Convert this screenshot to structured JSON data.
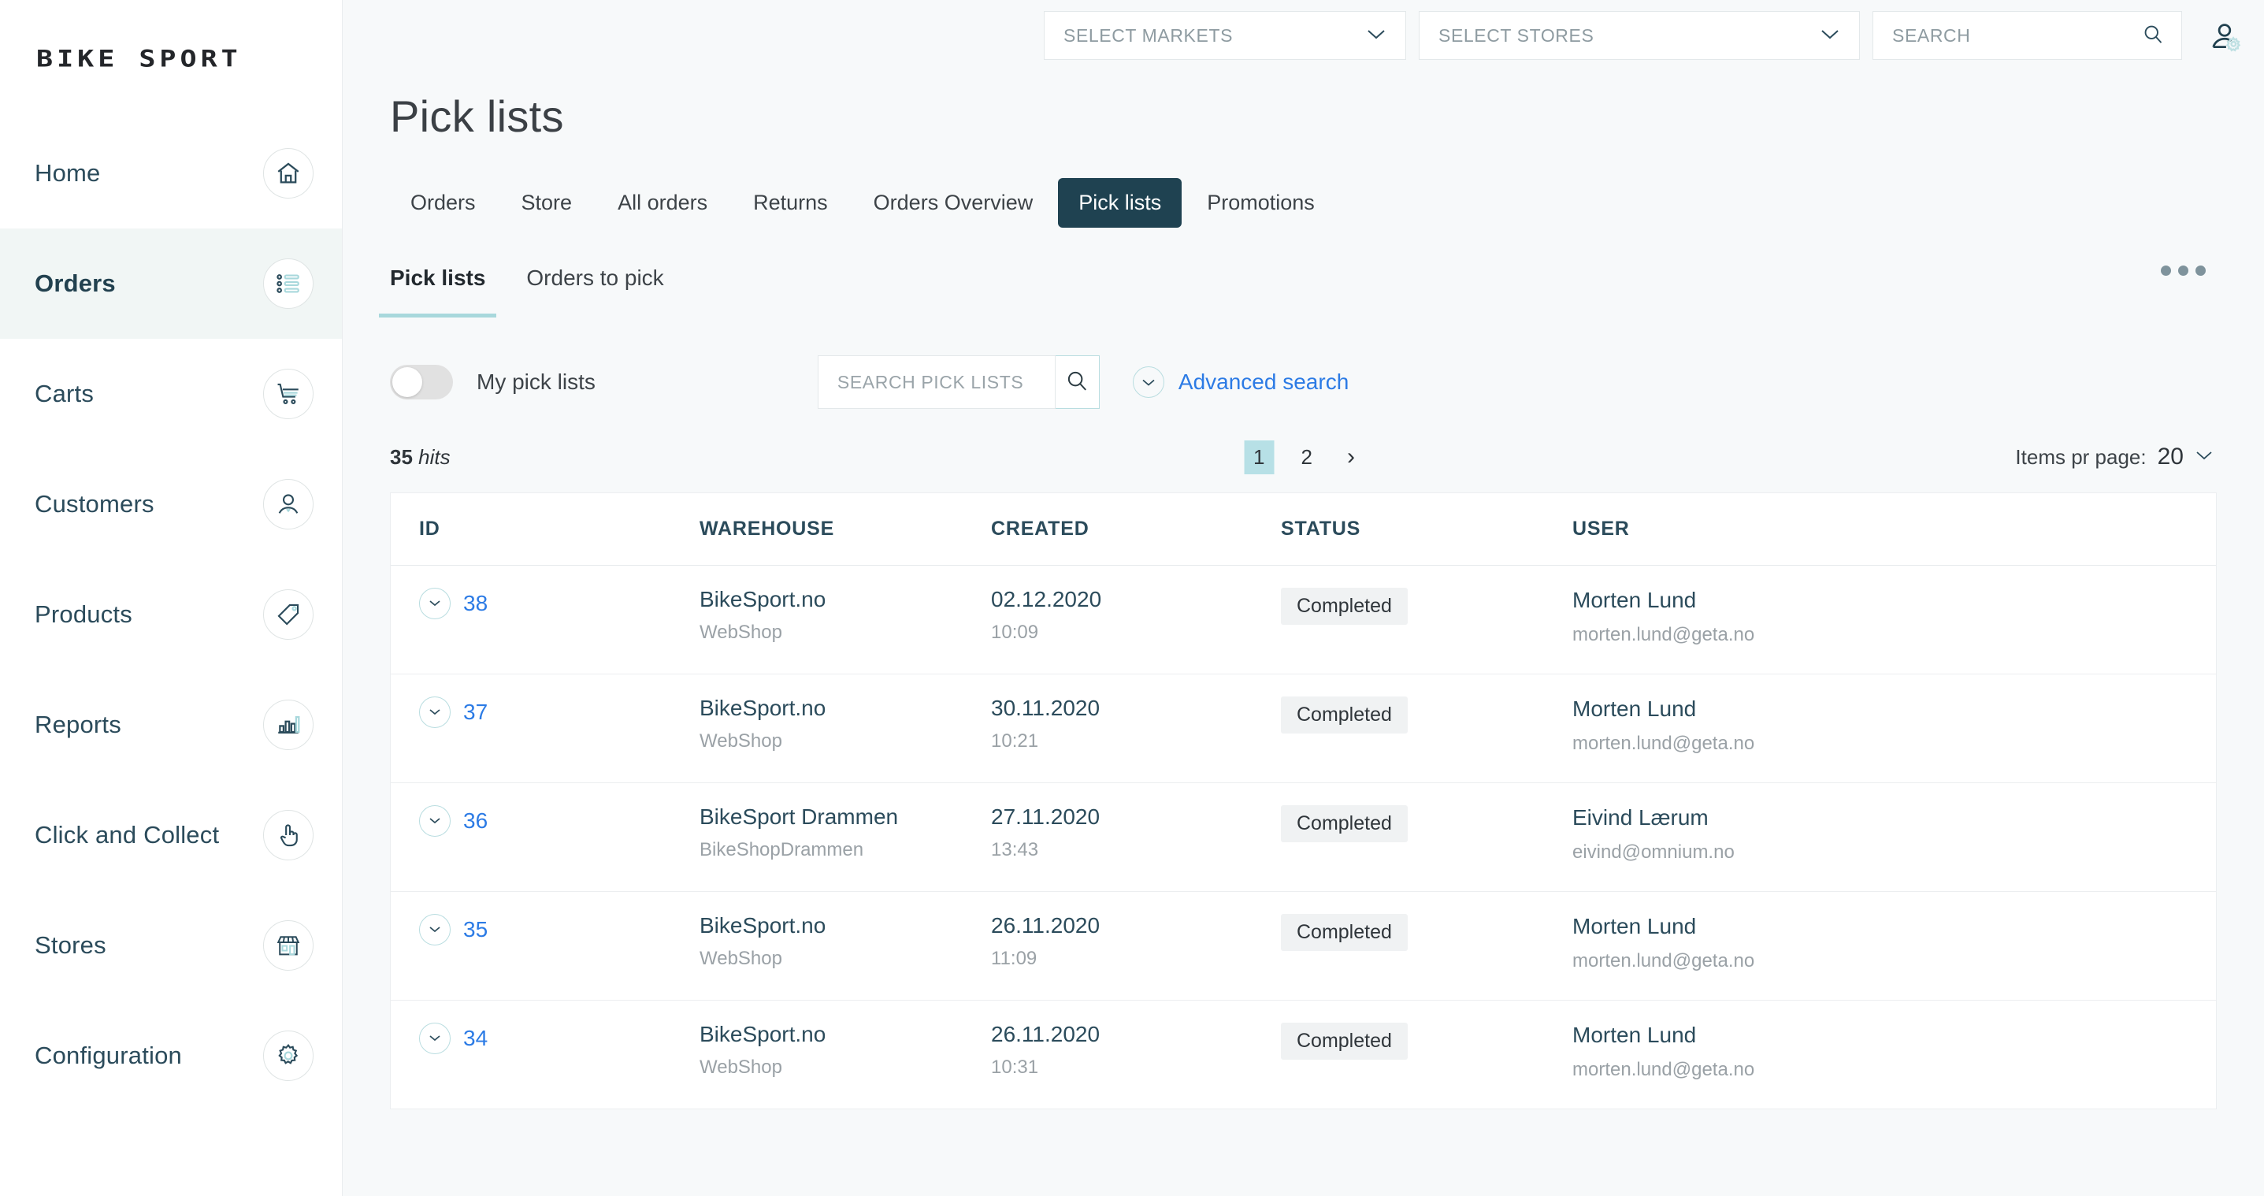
{
  "brand": {
    "logo": "BIKE SPORT"
  },
  "header": {
    "select_markets": "SELECT MARKETS",
    "select_stores": "SELECT STORES",
    "search_placeholder": "SEARCH",
    "search_value": "",
    "avatar_icon": "user-settings-icon"
  },
  "sidebar": {
    "items": [
      {
        "label": "Home",
        "icon": "home-icon",
        "active": false
      },
      {
        "label": "Orders",
        "icon": "list-icon",
        "active": true
      },
      {
        "label": "Carts",
        "icon": "cart-icon",
        "active": false
      },
      {
        "label": "Customers",
        "icon": "customer-icon",
        "active": false
      },
      {
        "label": "Products",
        "icon": "tag-icon",
        "active": false
      },
      {
        "label": "Reports",
        "icon": "bar-chart-icon",
        "active": false
      },
      {
        "label": "Click and Collect",
        "icon": "pointing-hand-icon",
        "active": false
      },
      {
        "label": "Stores",
        "icon": "storefront-icon",
        "active": false
      },
      {
        "label": "Configuration",
        "icon": "gear-icon",
        "active": false
      }
    ]
  },
  "page": {
    "title": "Pick lists"
  },
  "tabs": [
    {
      "label": "Orders",
      "active": false
    },
    {
      "label": "Store",
      "active": false
    },
    {
      "label": "All orders",
      "active": false
    },
    {
      "label": "Returns",
      "active": false
    },
    {
      "label": "Orders Overview",
      "active": false
    },
    {
      "label": "Pick lists",
      "active": true
    },
    {
      "label": "Promotions",
      "active": false
    }
  ],
  "subtabs": [
    {
      "label": "Pick lists",
      "active": true
    },
    {
      "label": "Orders to pick",
      "active": false
    }
  ],
  "toolbar": {
    "toggle_label": "My pick lists",
    "toggle_on": false,
    "search_placeholder": "SEARCH PICK LISTS",
    "search_value": "",
    "search_icon": "search-icon",
    "advanced_search_label": "Advanced search",
    "advanced_search_icon": "chevron-down-icon",
    "overflow_icon": "ellipsis-icon"
  },
  "results": {
    "hits_count": "35",
    "hits_label": "hits",
    "pages": [
      "1",
      "2"
    ],
    "current_page": "1",
    "next_icon": "chevron-right-icon",
    "items_pr_page_label": "Items pr page:",
    "items_pr_page_value": "20"
  },
  "table": {
    "columns": [
      "ID",
      "WAREHOUSE",
      "CREATED",
      "STATUS",
      "USER"
    ],
    "rows": [
      {
        "id": "38",
        "warehouse": "BikeSport.no",
        "warehouse_sub": "WebShop",
        "created_date": "02.12.2020",
        "created_time": "10:09",
        "status": "Completed",
        "user_name": "Morten Lund",
        "user_email": "morten.lund@geta.no"
      },
      {
        "id": "37",
        "warehouse": "BikeSport.no",
        "warehouse_sub": "WebShop",
        "created_date": "30.11.2020",
        "created_time": "10:21",
        "status": "Completed",
        "user_name": "Morten Lund",
        "user_email": "morten.lund@geta.no"
      },
      {
        "id": "36",
        "warehouse": "BikeSport Drammen",
        "warehouse_sub": "BikeShopDrammen",
        "created_date": "27.11.2020",
        "created_time": "13:43",
        "status": "Completed",
        "user_name": "Eivind Lærum",
        "user_email": "eivind@omnium.no"
      },
      {
        "id": "35",
        "warehouse": "BikeSport.no",
        "warehouse_sub": "WebShop",
        "created_date": "26.11.2020",
        "created_time": "11:09",
        "status": "Completed",
        "user_name": "Morten Lund",
        "user_email": "morten.lund@geta.no"
      },
      {
        "id": "34",
        "warehouse": "BikeSport.no",
        "warehouse_sub": "WebShop",
        "created_date": "26.11.2020",
        "created_time": "10:31",
        "status": "Completed",
        "user_name": "Morten Lund",
        "user_email": "morten.lund@geta.no"
      }
    ]
  },
  "colors": {
    "accent_dark": "#1f4251",
    "accent_teal": "#a8d8dc",
    "link_blue": "#2c7be5",
    "page_bg": "#f7f9fa",
    "sidebar_active_bg": "#f1f6f5",
    "badge_bg": "#f0f2f3"
  }
}
